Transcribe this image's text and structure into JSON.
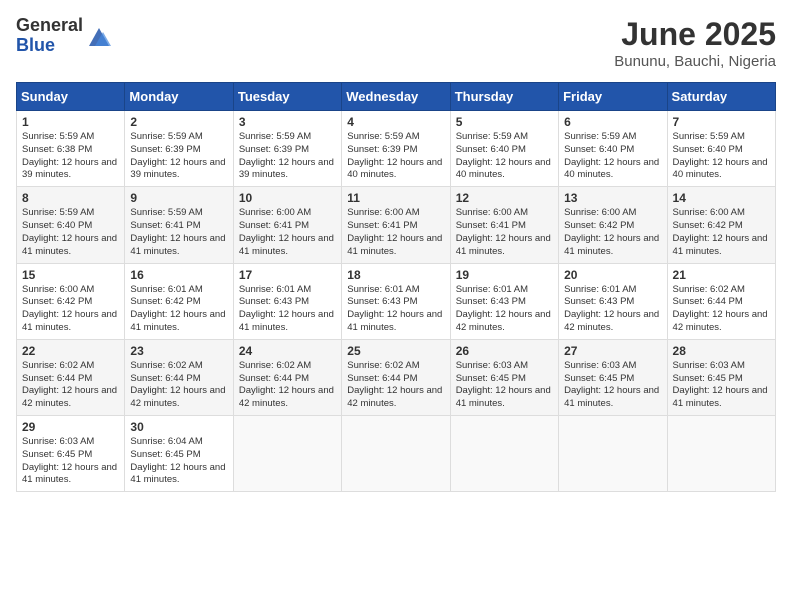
{
  "header": {
    "logo_general": "General",
    "logo_blue": "Blue",
    "month_title": "June 2025",
    "location": "Bununu, Bauchi, Nigeria"
  },
  "calendar": {
    "days_of_week": [
      "Sunday",
      "Monday",
      "Tuesday",
      "Wednesday",
      "Thursday",
      "Friday",
      "Saturday"
    ],
    "weeks": [
      [
        {
          "day": "1",
          "sunrise": "Sunrise: 5:59 AM",
          "sunset": "Sunset: 6:38 PM",
          "daylight": "Daylight: 12 hours and 39 minutes."
        },
        {
          "day": "2",
          "sunrise": "Sunrise: 5:59 AM",
          "sunset": "Sunset: 6:39 PM",
          "daylight": "Daylight: 12 hours and 39 minutes."
        },
        {
          "day": "3",
          "sunrise": "Sunrise: 5:59 AM",
          "sunset": "Sunset: 6:39 PM",
          "daylight": "Daylight: 12 hours and 39 minutes."
        },
        {
          "day": "4",
          "sunrise": "Sunrise: 5:59 AM",
          "sunset": "Sunset: 6:39 PM",
          "daylight": "Daylight: 12 hours and 40 minutes."
        },
        {
          "day": "5",
          "sunrise": "Sunrise: 5:59 AM",
          "sunset": "Sunset: 6:40 PM",
          "daylight": "Daylight: 12 hours and 40 minutes."
        },
        {
          "day": "6",
          "sunrise": "Sunrise: 5:59 AM",
          "sunset": "Sunset: 6:40 PM",
          "daylight": "Daylight: 12 hours and 40 minutes."
        },
        {
          "day": "7",
          "sunrise": "Sunrise: 5:59 AM",
          "sunset": "Sunset: 6:40 PM",
          "daylight": "Daylight: 12 hours and 40 minutes."
        }
      ],
      [
        {
          "day": "8",
          "sunrise": "Sunrise: 5:59 AM",
          "sunset": "Sunset: 6:40 PM",
          "daylight": "Daylight: 12 hours and 41 minutes."
        },
        {
          "day": "9",
          "sunrise": "Sunrise: 5:59 AM",
          "sunset": "Sunset: 6:41 PM",
          "daylight": "Daylight: 12 hours and 41 minutes."
        },
        {
          "day": "10",
          "sunrise": "Sunrise: 6:00 AM",
          "sunset": "Sunset: 6:41 PM",
          "daylight": "Daylight: 12 hours and 41 minutes."
        },
        {
          "day": "11",
          "sunrise": "Sunrise: 6:00 AM",
          "sunset": "Sunset: 6:41 PM",
          "daylight": "Daylight: 12 hours and 41 minutes."
        },
        {
          "day": "12",
          "sunrise": "Sunrise: 6:00 AM",
          "sunset": "Sunset: 6:41 PM",
          "daylight": "Daylight: 12 hours and 41 minutes."
        },
        {
          "day": "13",
          "sunrise": "Sunrise: 6:00 AM",
          "sunset": "Sunset: 6:42 PM",
          "daylight": "Daylight: 12 hours and 41 minutes."
        },
        {
          "day": "14",
          "sunrise": "Sunrise: 6:00 AM",
          "sunset": "Sunset: 6:42 PM",
          "daylight": "Daylight: 12 hours and 41 minutes."
        }
      ],
      [
        {
          "day": "15",
          "sunrise": "Sunrise: 6:00 AM",
          "sunset": "Sunset: 6:42 PM",
          "daylight": "Daylight: 12 hours and 41 minutes."
        },
        {
          "day": "16",
          "sunrise": "Sunrise: 6:01 AM",
          "sunset": "Sunset: 6:42 PM",
          "daylight": "Daylight: 12 hours and 41 minutes."
        },
        {
          "day": "17",
          "sunrise": "Sunrise: 6:01 AM",
          "sunset": "Sunset: 6:43 PM",
          "daylight": "Daylight: 12 hours and 41 minutes."
        },
        {
          "day": "18",
          "sunrise": "Sunrise: 6:01 AM",
          "sunset": "Sunset: 6:43 PM",
          "daylight": "Daylight: 12 hours and 41 minutes."
        },
        {
          "day": "19",
          "sunrise": "Sunrise: 6:01 AM",
          "sunset": "Sunset: 6:43 PM",
          "daylight": "Daylight: 12 hours and 42 minutes."
        },
        {
          "day": "20",
          "sunrise": "Sunrise: 6:01 AM",
          "sunset": "Sunset: 6:43 PM",
          "daylight": "Daylight: 12 hours and 42 minutes."
        },
        {
          "day": "21",
          "sunrise": "Sunrise: 6:02 AM",
          "sunset": "Sunset: 6:44 PM",
          "daylight": "Daylight: 12 hours and 42 minutes."
        }
      ],
      [
        {
          "day": "22",
          "sunrise": "Sunrise: 6:02 AM",
          "sunset": "Sunset: 6:44 PM",
          "daylight": "Daylight: 12 hours and 42 minutes."
        },
        {
          "day": "23",
          "sunrise": "Sunrise: 6:02 AM",
          "sunset": "Sunset: 6:44 PM",
          "daylight": "Daylight: 12 hours and 42 minutes."
        },
        {
          "day": "24",
          "sunrise": "Sunrise: 6:02 AM",
          "sunset": "Sunset: 6:44 PM",
          "daylight": "Daylight: 12 hours and 42 minutes."
        },
        {
          "day": "25",
          "sunrise": "Sunrise: 6:02 AM",
          "sunset": "Sunset: 6:44 PM",
          "daylight": "Daylight: 12 hours and 42 minutes."
        },
        {
          "day": "26",
          "sunrise": "Sunrise: 6:03 AM",
          "sunset": "Sunset: 6:45 PM",
          "daylight": "Daylight: 12 hours and 41 minutes."
        },
        {
          "day": "27",
          "sunrise": "Sunrise: 6:03 AM",
          "sunset": "Sunset: 6:45 PM",
          "daylight": "Daylight: 12 hours and 41 minutes."
        },
        {
          "day": "28",
          "sunrise": "Sunrise: 6:03 AM",
          "sunset": "Sunset: 6:45 PM",
          "daylight": "Daylight: 12 hours and 41 minutes."
        }
      ],
      [
        {
          "day": "29",
          "sunrise": "Sunrise: 6:03 AM",
          "sunset": "Sunset: 6:45 PM",
          "daylight": "Daylight: 12 hours and 41 minutes."
        },
        {
          "day": "30",
          "sunrise": "Sunrise: 6:04 AM",
          "sunset": "Sunset: 6:45 PM",
          "daylight": "Daylight: 12 hours and 41 minutes."
        },
        null,
        null,
        null,
        null,
        null
      ]
    ]
  }
}
